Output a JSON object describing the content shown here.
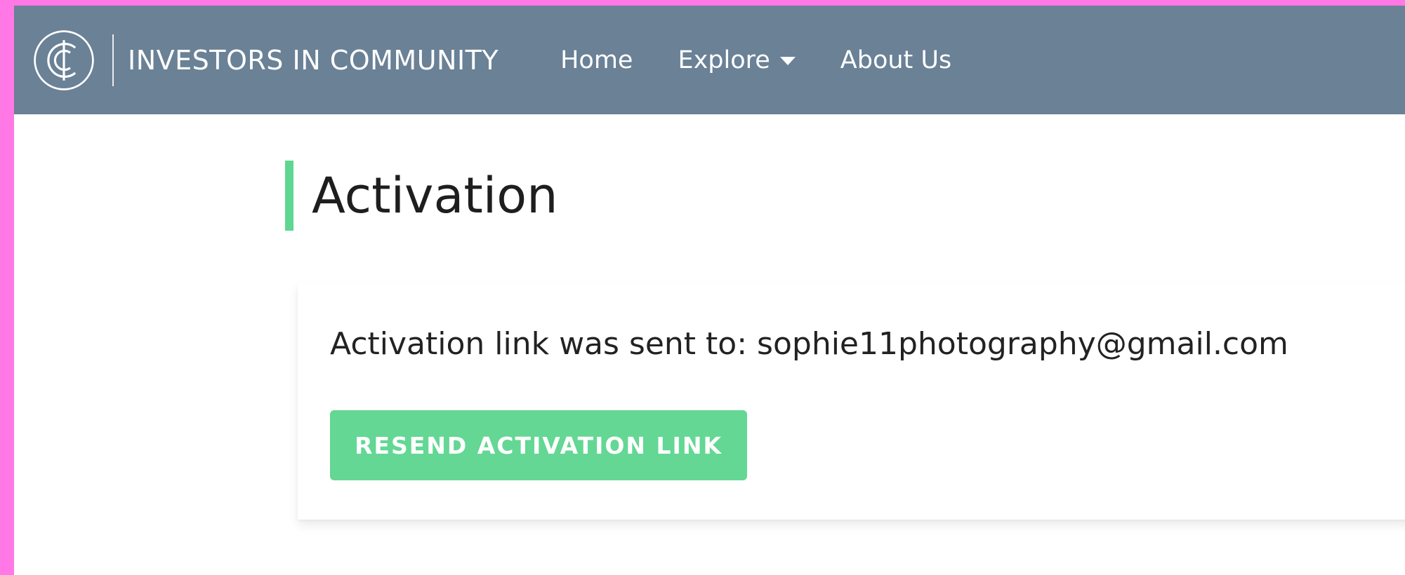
{
  "navbar": {
    "brand_name": "INVESTORS IN COMMUNITY",
    "logo_icon": "ic-monogram-logo-icon",
    "links": {
      "home": "Home",
      "explore": "Explore",
      "about": "About Us"
    },
    "background": "#6a8196"
  },
  "page": {
    "title": "Activation",
    "accent_color": "#5fd691"
  },
  "activation": {
    "message_label": "Activation link was sent to:",
    "email": "sophie11photography@gmail.com",
    "resend_label": "RESEND ACTIVATION LINK",
    "button_color": "#63d793"
  }
}
